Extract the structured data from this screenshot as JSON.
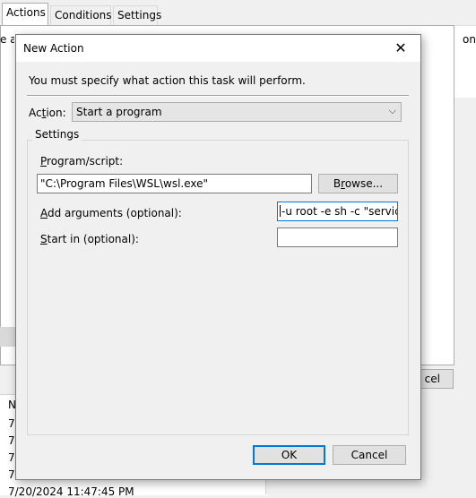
{
  "background": {
    "tabs": [
      "Actions",
      "Conditions",
      "Settings"
    ],
    "left_edge_text": "e a",
    "right_edge_text": "on",
    "cancel_fragment": "cel",
    "list_header": "N",
    "list_rows": [
      "7",
      "7",
      "7",
      "7",
      "7/20/2024 11:47:45 PM"
    ]
  },
  "dialog": {
    "title": "New Action",
    "close_glyph": "✕",
    "intro": "You must specify what action this task will perform.",
    "action": {
      "label_pre": "Ac",
      "label_ul": "t",
      "label_post": "ion:",
      "value": "Start a program",
      "chevron": "⌵"
    },
    "settings_legend": "Settings",
    "program": {
      "label_ul": "P",
      "label_post": "rogram/script:",
      "value": "\"C:\\Program Files\\WSL\\wsl.exe\"",
      "browse_pre": "B",
      "browse_ul": "r",
      "browse_post": "owse..."
    },
    "arguments": {
      "label_ul": "A",
      "label_post": "dd arguments (optional):",
      "value": "-u root -e sh -c \"service c"
    },
    "start_in": {
      "label_ul": "S",
      "label_post": "tart in (optional):",
      "value": ""
    },
    "ok_label": "OK",
    "cancel_label": "Cancel"
  }
}
